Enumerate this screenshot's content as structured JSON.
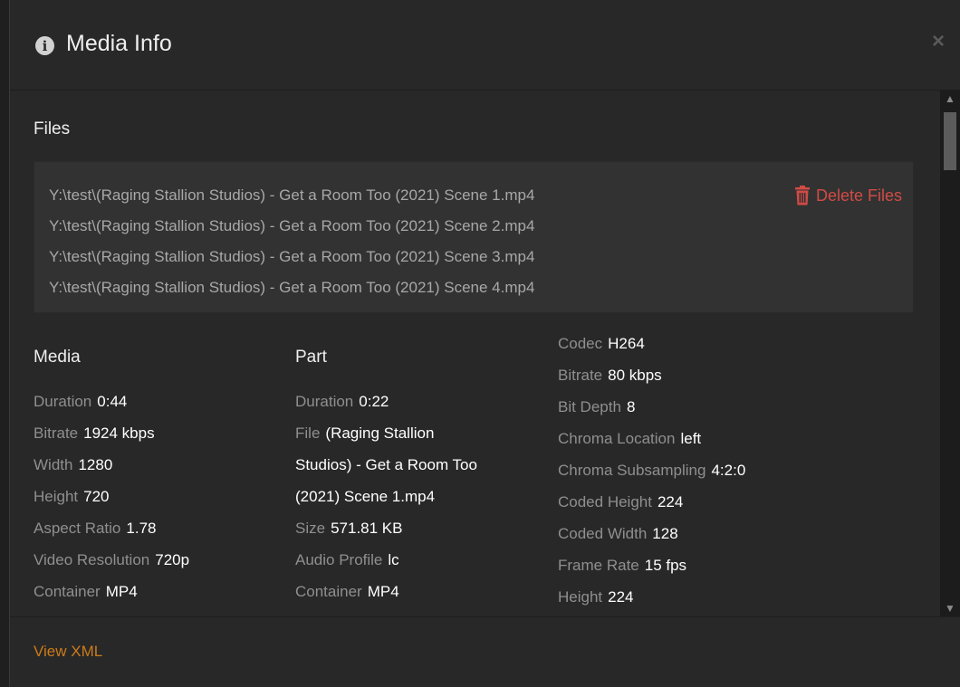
{
  "header": {
    "info_icon_glyph": "i",
    "title": "Media Info",
    "close_glyph": "×"
  },
  "files": {
    "title": "Files",
    "paths": [
      "Y:\\test\\(Raging Stallion Studios) - Get a Room Too (2021) Scene 1.mp4",
      "Y:\\test\\(Raging Stallion Studios) - Get a Room Too (2021) Scene 2.mp4",
      "Y:\\test\\(Raging Stallion Studios) - Get a Room Too (2021) Scene 3.mp4",
      "Y:\\test\\(Raging Stallion Studios) - Get a Room Too (2021) Scene 4.mp4"
    ],
    "delete_label": "Delete Files"
  },
  "media": {
    "title": "Media",
    "rows": [
      {
        "label": "Duration",
        "value": "0:44"
      },
      {
        "label": "Bitrate",
        "value": "1924 kbps"
      },
      {
        "label": "Width",
        "value": "1280"
      },
      {
        "label": "Height",
        "value": "720"
      },
      {
        "label": "Aspect Ratio",
        "value": "1.78"
      },
      {
        "label": "Video Resolution",
        "value": "720p"
      },
      {
        "label": "Container",
        "value": "MP4"
      }
    ]
  },
  "part": {
    "title": "Part",
    "duration": {
      "label": "Duration",
      "value": "0:22"
    },
    "file": {
      "label": "File",
      "value_line1": "(Raging Stallion",
      "value_line2": "Studios) - Get a Room Too",
      "value_line3": "(2021) Scene 1.mp4"
    },
    "size": {
      "label": "Size",
      "value": "571.81 KB"
    },
    "audio_profile": {
      "label": "Audio Profile",
      "value": "lc"
    },
    "container": {
      "label": "Container",
      "value": "MP4"
    }
  },
  "stream": {
    "rows": [
      {
        "label": "Codec",
        "value": "H264"
      },
      {
        "label": "Bitrate",
        "value": "80 kbps"
      },
      {
        "label": "Bit Depth",
        "value": "8"
      },
      {
        "label": "Chroma Location",
        "value": "left"
      },
      {
        "label": "Chroma Subsampling",
        "value": "4:2:0"
      },
      {
        "label": "Coded Height",
        "value": "224"
      },
      {
        "label": "Coded Width",
        "value": "128"
      },
      {
        "label": "Frame Rate",
        "value": "15 fps"
      },
      {
        "label": "Height",
        "value": "224"
      }
    ]
  },
  "footer": {
    "view_xml_label": "View XML"
  },
  "colors": {
    "background": "#282828",
    "delete": "#d24b45",
    "link": "#cc7b19"
  }
}
